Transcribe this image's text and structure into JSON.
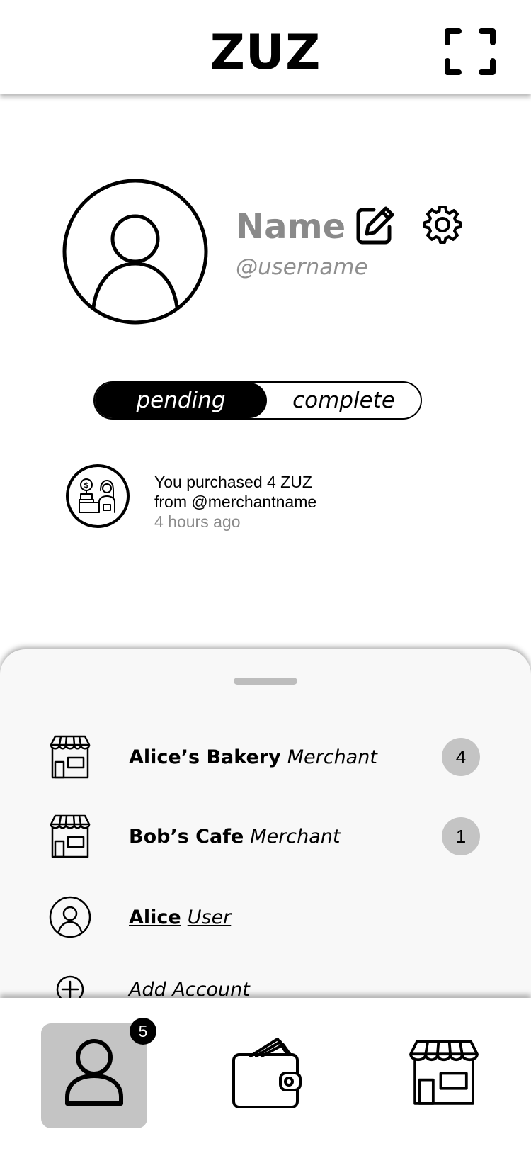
{
  "header": {
    "title": "ZUZ",
    "scan_icon": "scan-frame-icon"
  },
  "profile": {
    "name": "Name",
    "username": "@username",
    "avatar_icon": "user-avatar-icon",
    "edit_icon": "edit-icon",
    "settings_icon": "gear-icon"
  },
  "filter": {
    "pending": "pending",
    "complete": "complete",
    "selected": "pending"
  },
  "activity": [
    {
      "line1": "You purchased 4 ZUZ",
      "line2": "from @merchantname",
      "time": "4 hours ago",
      "icon": "merchant-cashier-icon"
    }
  ],
  "accounts": {
    "items": [
      {
        "name": "Alice’s Bakery",
        "type": "Merchant",
        "count": "4",
        "icon": "store-icon"
      },
      {
        "name": "Bob’s Cafe",
        "type": "Merchant",
        "count": "1",
        "icon": "store-icon"
      },
      {
        "name": "Alice",
        "type": "User",
        "icon": "user-icon",
        "current": true
      }
    ],
    "add_label": "Add Account",
    "add_icon": "plus-circle-icon"
  },
  "nav": {
    "profile_badge": "5",
    "items": [
      {
        "icon": "user-icon",
        "active": true
      },
      {
        "icon": "wallet-icon",
        "active": false
      },
      {
        "icon": "store-icon",
        "active": false
      }
    ]
  },
  "colors": {
    "muted_text": "#8a8a8a",
    "badge_gray": "#c4c4c4",
    "sheet_bg": "#f8f8f8"
  }
}
